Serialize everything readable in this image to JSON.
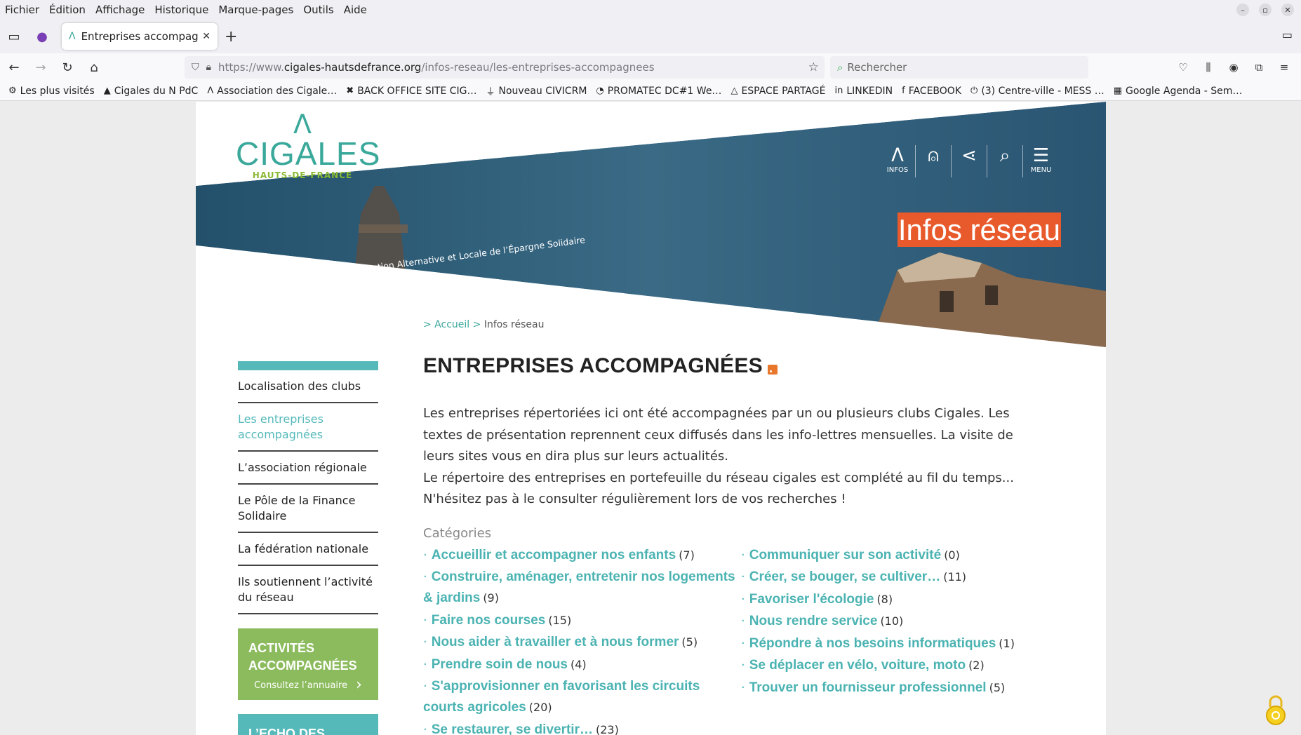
{
  "menubar": {
    "items": [
      "Fichier",
      "Édition",
      "Affichage",
      "Historique",
      "Marque-pages",
      "Outils",
      "Aide"
    ]
  },
  "tab": {
    "title": "Entreprises accompagné",
    "close": "✕"
  },
  "navbar": {
    "url_prefix": "https://www.",
    "url_host": "cigales-hautsdefrance.org",
    "url_path": "/infos-reseau/les-entreprises-accompagnees",
    "search_placeholder": "Rechercher"
  },
  "bookmarks": [
    {
      "icon": "gear-icon",
      "glyph": "⚙",
      "label": "Les plus visités"
    },
    {
      "icon": "cigales-icon",
      "glyph": "▲",
      "label": "Cigales du N PdC"
    },
    {
      "icon": "cigales-icon",
      "glyph": "ᐱ",
      "label": "Association des Cigale…"
    },
    {
      "icon": "joomla-icon",
      "glyph": "✖",
      "label": "BACK OFFICE SITE CIG…"
    },
    {
      "icon": "civicrm-icon",
      "glyph": "⏚",
      "label": "Nouveau CIVICRM"
    },
    {
      "icon": "promatec-icon",
      "glyph": "◔",
      "label": "PROMATEC DC#1 We…"
    },
    {
      "icon": "drive-icon",
      "glyph": "△",
      "label": "ESPACE PARTAGÉ"
    },
    {
      "icon": "linkedin-icon",
      "glyph": "in",
      "label": "LINKEDIN"
    },
    {
      "icon": "facebook-icon",
      "glyph": "f",
      "label": "FACEBOOK"
    },
    {
      "icon": "power-icon",
      "glyph": "⏻",
      "label": "(3) Centre-ville - MESS …"
    },
    {
      "icon": "calendar-icon",
      "glyph": "▦",
      "label": "Google Agenda - Sem…"
    }
  ],
  "site": {
    "logo_word": "CIGALES",
    "logo_sub": "HAUTS-DE-FRANCE",
    "tagline": "Club d’Investisseurs pour une Gestion Alternative et Locale de l’Épargne Solidaire",
    "header_icons": [
      {
        "name": "infos-icon",
        "glyph": "ᐱ",
        "label": "INFOS"
      },
      {
        "name": "user-icon",
        "glyph": "⍝",
        "label": ""
      },
      {
        "name": "share-icon",
        "glyph": "⋖",
        "label": ""
      },
      {
        "name": "search-icon",
        "glyph": "⌕",
        "label": ""
      },
      {
        "name": "menu-icon",
        "glyph": "☰",
        "label": "MENU"
      }
    ],
    "section_title": "Infos réseau",
    "breadcrumb": {
      "home": "> Accueil",
      "sep": ">",
      "current": "Infos réseau"
    },
    "sidebar": {
      "items": [
        {
          "label": "Localisation des clubs",
          "active": false
        },
        {
          "label": "Les entreprises accompagnées",
          "active": true
        },
        {
          "label": "L’association régionale",
          "active": false
        },
        {
          "label": "Le Pôle de la Finance Solidaire",
          "active": false
        },
        {
          "label": "La fédération nationale",
          "active": false
        },
        {
          "label": "Ils soutiennent l’activité du réseau",
          "active": false
        }
      ],
      "box1": {
        "title": "ACTIVITÉS ACCOMPAGNÉES",
        "sub": "Consultez l’annuaire"
      },
      "box2": {
        "title": "L’ECHO DES"
      }
    },
    "page_title": "ENTREPRISES ACCOMPAGNÉES",
    "intro1": "Les entreprises répertoriées ici ont été accompagnées par un ou plusieurs clubs Cigales. Les textes de présentation reprennent ceux diffusés dans les info-lettres mensuelles. La visite de leurs sites vous en dira plus sur leurs actualités.",
    "intro2": "Le répertoire des entreprises en portefeuille du réseau cigales est complété au fil du temps... N'hésitez pas à le consulter régulièrement lors de vos recherches  !",
    "categories_title": "Catégories",
    "categories_left": [
      {
        "name": "Accueillir et accompagner nos enfants",
        "count": "(7)"
      },
      {
        "name": "Construire, aménager, entretenir nos logements & jardins",
        "count": "(9)"
      },
      {
        "name": "Faire nos courses",
        "count": "(15)"
      },
      {
        "name": "Nous aider à travailler et à nous former",
        "count": "(5)"
      },
      {
        "name": "Prendre soin de nous",
        "count": "(4)"
      },
      {
        "name": "S'approvisionner en favorisant les circuits courts agricoles",
        "count": "(20)"
      },
      {
        "name": "Se restaurer, se divertir…",
        "count": "(23)"
      }
    ],
    "categories_right": [
      {
        "name": "Communiquer sur son activité",
        "count": "(0)"
      },
      {
        "name": "Créer, se bouger, se cultiver…",
        "count": "(11)"
      },
      {
        "name": "Favoriser l'écologie",
        "count": "(8)"
      },
      {
        "name": "Nous rendre service",
        "count": "(10)"
      },
      {
        "name": "Répondre à nos besoins informatiques",
        "count": "(1)"
      },
      {
        "name": "Se déplacer en vélo, voiture, moto",
        "count": "(2)"
      },
      {
        "name": "Trouver un fournisseur professionnel",
        "count": "(5)"
      }
    ]
  },
  "colors": {
    "teal": "#55b9ba",
    "green": "#8cbb5e",
    "orange": "#e85a2b",
    "header_blue": "#2b5470"
  }
}
